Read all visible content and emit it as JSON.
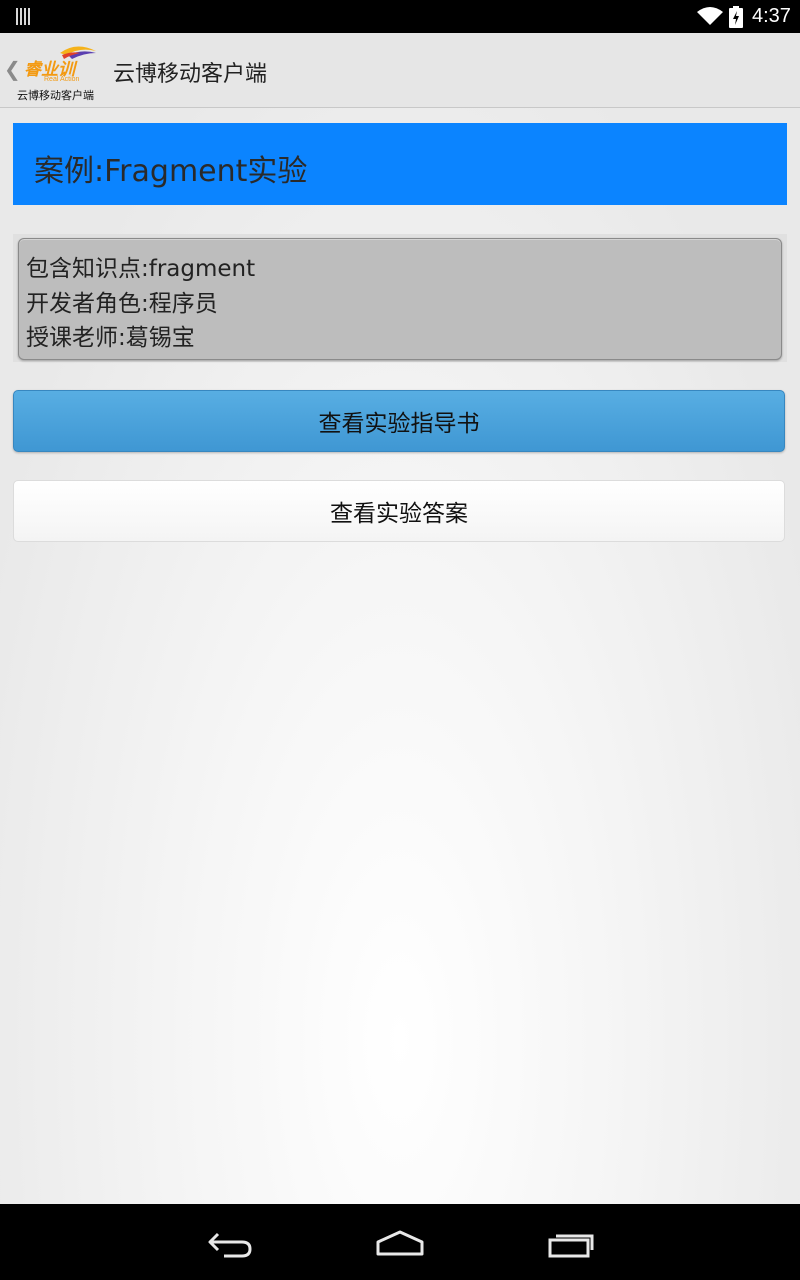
{
  "status_bar": {
    "time": "4:37",
    "icons": [
      "notification-icon",
      "wifi-icon",
      "battery-charging-icon"
    ]
  },
  "action_bar": {
    "logo_text": "睿业训",
    "logo_en": "Real Action",
    "logo_subtitle": "云博移动客户端",
    "title": "云博移动客户端"
  },
  "case": {
    "title": "案例:Fragment实验"
  },
  "info": {
    "lines": [
      "包含知识点:fragment",
      "开发者角色:程序员",
      "授课老师:葛锡宝"
    ]
  },
  "buttons": {
    "guide_label": "查看实验指导书",
    "answer_label": "查看实验答案"
  },
  "colors": {
    "header_blue": "#0b84ff",
    "guide_button": "#4aa3dc",
    "logo_orange": "#f39a12"
  },
  "nav_bar": {
    "icons": [
      "back-icon",
      "home-icon",
      "recents-icon"
    ]
  }
}
